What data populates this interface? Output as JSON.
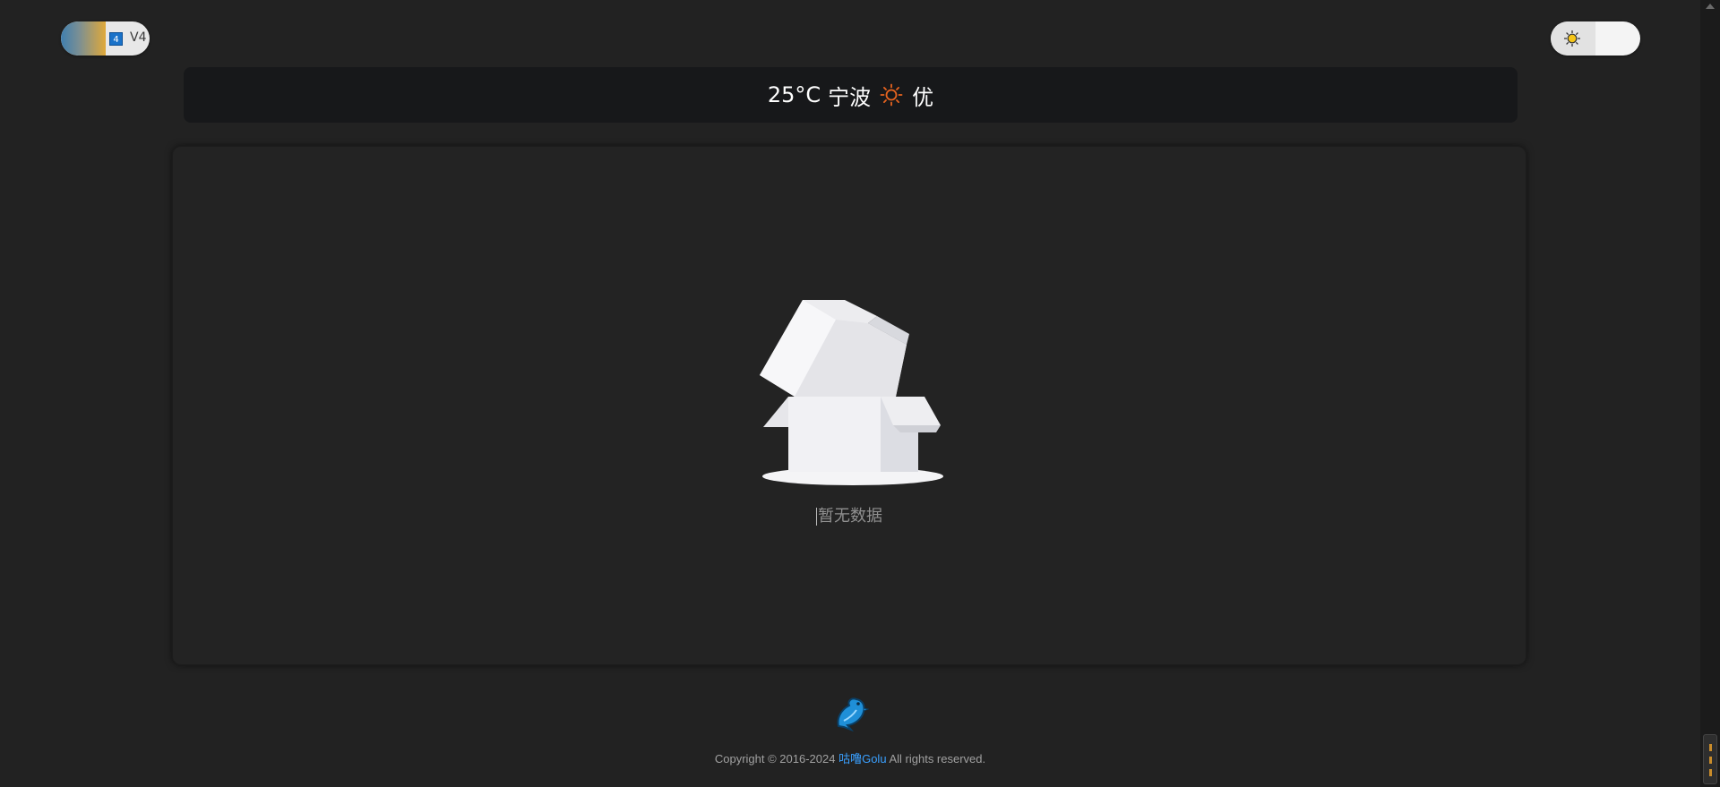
{
  "header": {
    "version_toggle": {
      "badge": "4",
      "label": "V4"
    },
    "theme_toggle": {
      "icon": "sun-icon"
    }
  },
  "weather": {
    "temperature": "25°C",
    "city": "宁波",
    "condition_icon": "sun-icon",
    "air_quality": "优"
  },
  "main": {
    "empty_icon": "empty-box-icon",
    "empty_text": "暂无数据"
  },
  "footer": {
    "logo_icon": "dolphin-icon",
    "copyright_prefix": "Copyright © 2016-2024",
    "brand": "咕噜Golu",
    "rights": "All rights reserved."
  },
  "colors": {
    "background": "#222222",
    "weather_bar": "#17181a",
    "link": "#3aa0ff",
    "sun_orange": "#e8641f"
  }
}
